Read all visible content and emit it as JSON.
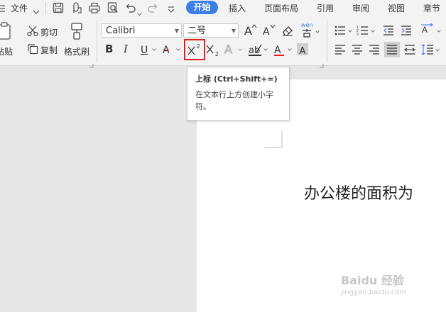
{
  "menubar": {
    "file": "文件",
    "tabs": [
      "开始",
      "插入",
      "页面布局",
      "引用",
      "审阅",
      "视图",
      "章节"
    ]
  },
  "clipboard": {
    "paste": "粘贴",
    "cut": "剪切",
    "copy": "复制",
    "format_painter": "格式刷"
  },
  "font": {
    "name": "Calibri",
    "size": "二号",
    "bold": "B",
    "italic": "I",
    "underline": "U",
    "strikethrough": "A",
    "text_effect": "A",
    "highlight": "ab",
    "font_color": "A",
    "char_shading": "A",
    "grow": "A",
    "shrink": "A",
    "phonetic": "wén"
  },
  "tooltip": {
    "title": "上标 (Ctrl+Shift+=)",
    "description": "在文本行上方创建小字符。"
  },
  "document": {
    "text": "办公楼的面积为"
  },
  "watermark": {
    "main": "Baidu 经验",
    "sub": "jingyan.baidu.com"
  }
}
